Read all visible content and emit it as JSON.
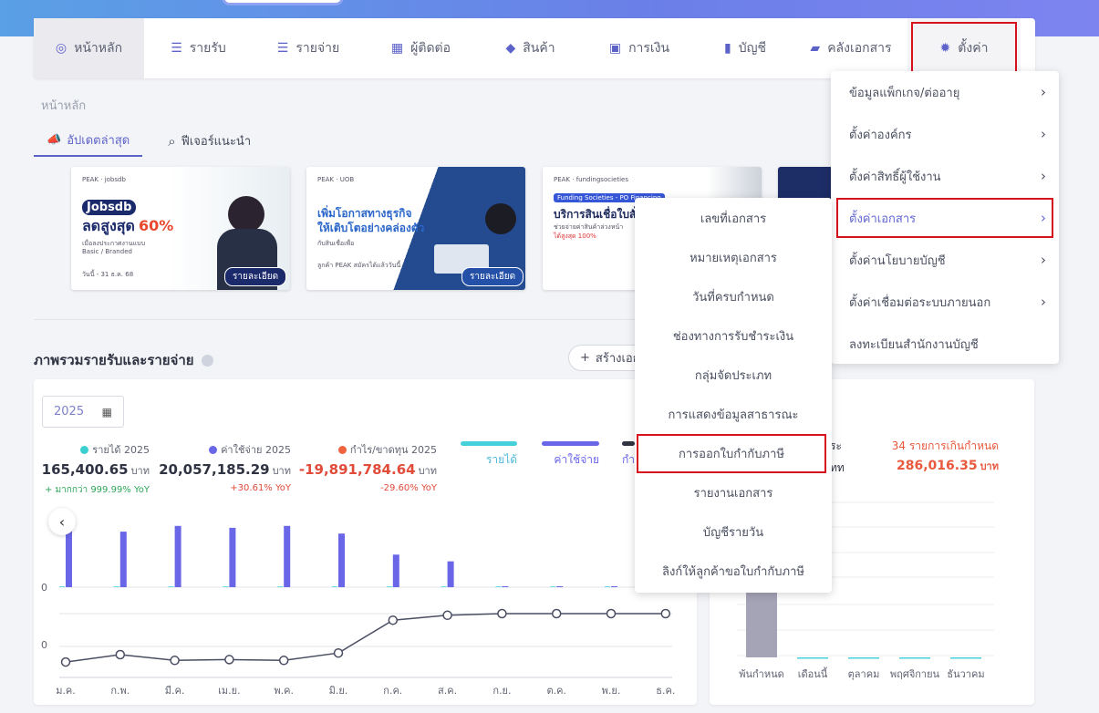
{
  "nav": {
    "items": [
      {
        "label": "หน้าหลัก",
        "icon": "dashboard-icon"
      },
      {
        "label": "รายรับ",
        "icon": "income-list-icon"
      },
      {
        "label": "รายจ่าย",
        "icon": "expense-list-icon"
      },
      {
        "label": "ผู้ติดต่อ",
        "icon": "contacts-icon"
      },
      {
        "label": "สินค้า",
        "icon": "product-box-icon"
      },
      {
        "label": "การเงิน",
        "icon": "money-icon"
      },
      {
        "label": "บัญชี",
        "icon": "ledger-icon"
      },
      {
        "label": "คลังเอกสาร",
        "icon": "folder-icon"
      },
      {
        "label": "ตั้งค่า",
        "icon": "gear-icon"
      }
    ]
  },
  "breadcrumb": "หน้าหลัก",
  "tabs": {
    "updates": "อัปเดตล่าสุด",
    "features": "ฟีเจอร์แนะนำ"
  },
  "banners": {
    "b1": {
      "brand": "PEAK · jobsdb",
      "title1": "Jobsdb",
      "title2": "ลดสูงสุด",
      "pct": "60%",
      "line1": "เมื่อลงประกาศงานแบบ",
      "line2": "Basic / Branded",
      "date": "วันนี้ - 31 ธ.ค. 68",
      "cta": "รายละเอียด"
    },
    "b2": {
      "brand": "PEAK · UOB",
      "title1": "เพิ่มโอกาสทางธุรกิจ",
      "title2": "ให้เติบโตอย่างคล่องตัว",
      "line1": "กับสินเชื่อเพื่อ",
      "line2": "ลูกค้า PEAK สมัครได้แล้ววันนี้",
      "cta": "รายละเอียด"
    },
    "b3": {
      "brand": "PEAK · fundingsocieties",
      "tag": "Funding Societies - PO Financing",
      "title": "บริการสินเชื่อใบสั่ง",
      "line1": "ช่วยจ่ายค่าสินค้าล่วงหน้า",
      "line2": "ได้สูงสุด 100%"
    }
  },
  "section": {
    "title": "ภาพรวมรายรับและรายจ่าย",
    "create": "สร้างเอกสาร"
  },
  "year": "2025",
  "stats": {
    "income": {
      "label": "รายได้ 2025",
      "value": "165,400.65",
      "unit": "บาท",
      "yoy": "+ มากกว่า 999.99% YoY",
      "color": "#3ccfcf"
    },
    "expense": {
      "label": "ค่าใช้จ่าย 2025",
      "value": "20,057,185.29",
      "unit": "บาท",
      "yoy": "+30.61% YoY",
      "color": "#6a66e8"
    },
    "profit": {
      "label": "กำไร/ขาดทุน 2025",
      "value": "-19,891,784.64",
      "unit": "บาท",
      "yoy": "-29.60% YoY",
      "color": "#f0633f"
    }
  },
  "legend": {
    "income": "รายได้",
    "expense": "ค่าใช้จ่าย",
    "profit": "กำ"
  },
  "right_card": {
    "label1": "ระ",
    "overdue": "34 รายการเกินกำหนด",
    "label2": "ทท",
    "amount": "286,016.35",
    "unit": "บาท",
    "x_labels": [
      "พ้นกำหนด",
      "เดือนนี้",
      "ตุลาคม",
      "พฤศจิกายน",
      "ธันวาคม"
    ]
  },
  "settings_menu": [
    {
      "label": "ข้อมูลแพ็กเกจ/ต่ออายุ",
      "arrow": "›"
    },
    {
      "label": "ตั้งค่าองค์กร",
      "arrow": "›"
    },
    {
      "label": "ตั้งค่าสิทธิ์ผู้ใช้งาน",
      "arrow": "›"
    },
    {
      "label": "ตั้งค่าเอกสาร",
      "arrow": "›"
    },
    {
      "label": "ตั้งค่านโยบายบัญชี",
      "arrow": "›"
    },
    {
      "label": "ตั้งค่าเชื่อมต่อระบบภายนอก",
      "arrow": "›"
    },
    {
      "label": "ลงทะเบียนสำนักงานบัญชี",
      "arrow": ""
    }
  ],
  "doc_submenu": [
    "เลขที่เอกสาร",
    "หมายเหตุเอกสาร",
    "วันที่ครบกำหนด",
    "ช่องทางการรับชำระเงิน",
    "กลุ่มจัดประเภท",
    "การแสดงข้อมูลสาธารณะ",
    "การออกใบกำกับภาษี",
    "รายงานเอกสาร",
    "บัญชีรายวัน",
    "ลิงก์ให้ลูกค้าขอใบกำกับภาษี"
  ],
  "chart_data": [
    {
      "type": "bar",
      "categories": [
        "ม.ค.",
        "ก.พ.",
        "มี.ค.",
        "เม.ย.",
        "พ.ค.",
        "มิ.ย.",
        "ก.ค.",
        "ส.ค.",
        "ก.ย.",
        "ต.ค.",
        "พ.ย.",
        "ธ.ค."
      ],
      "series": [
        {
          "name": "รายได้",
          "values": [
            0.4,
            0.4,
            0.4,
            0.4,
            0.4,
            0.4,
            0.4,
            0.4,
            0.4,
            0.4,
            0.4,
            0.4
          ]
        },
        {
          "name": "ค่าใช้จ่าย",
          "values": [
            2.95,
            2.9,
            3.2,
            3.1,
            3.2,
            2.8,
            1.7,
            1.35,
            0.05,
            0.05,
            0.05,
            0
          ]
        }
      ],
      "y_tick": "0"
    },
    {
      "type": "line",
      "categories": [
        "ม.ค.",
        "ก.พ.",
        "มี.ค.",
        "เม.ย.",
        "พ.ค.",
        "มิ.ย.",
        "ก.ค.",
        "ส.ค.",
        "ก.ย.",
        "ต.ค.",
        "พ.ย.",
        "ธ.ค."
      ],
      "series": [
        {
          "name": "กำไร/ขาดทุน",
          "values": [
            -2.95,
            -2.5,
            -2.85,
            -2.8,
            -2.85,
            -2.4,
            -0.4,
            -0.1,
            0,
            0,
            0,
            0
          ]
        }
      ],
      "y_tick": "0"
    },
    {
      "type": "bar",
      "categories": [
        "พ้นกำหนด",
        "เดือนนี้",
        "ตุลาคม",
        "พฤศจิกายน",
        "ธันวาคม"
      ],
      "values": [
        286016.35,
        0,
        0,
        0,
        0
      ]
    }
  ]
}
